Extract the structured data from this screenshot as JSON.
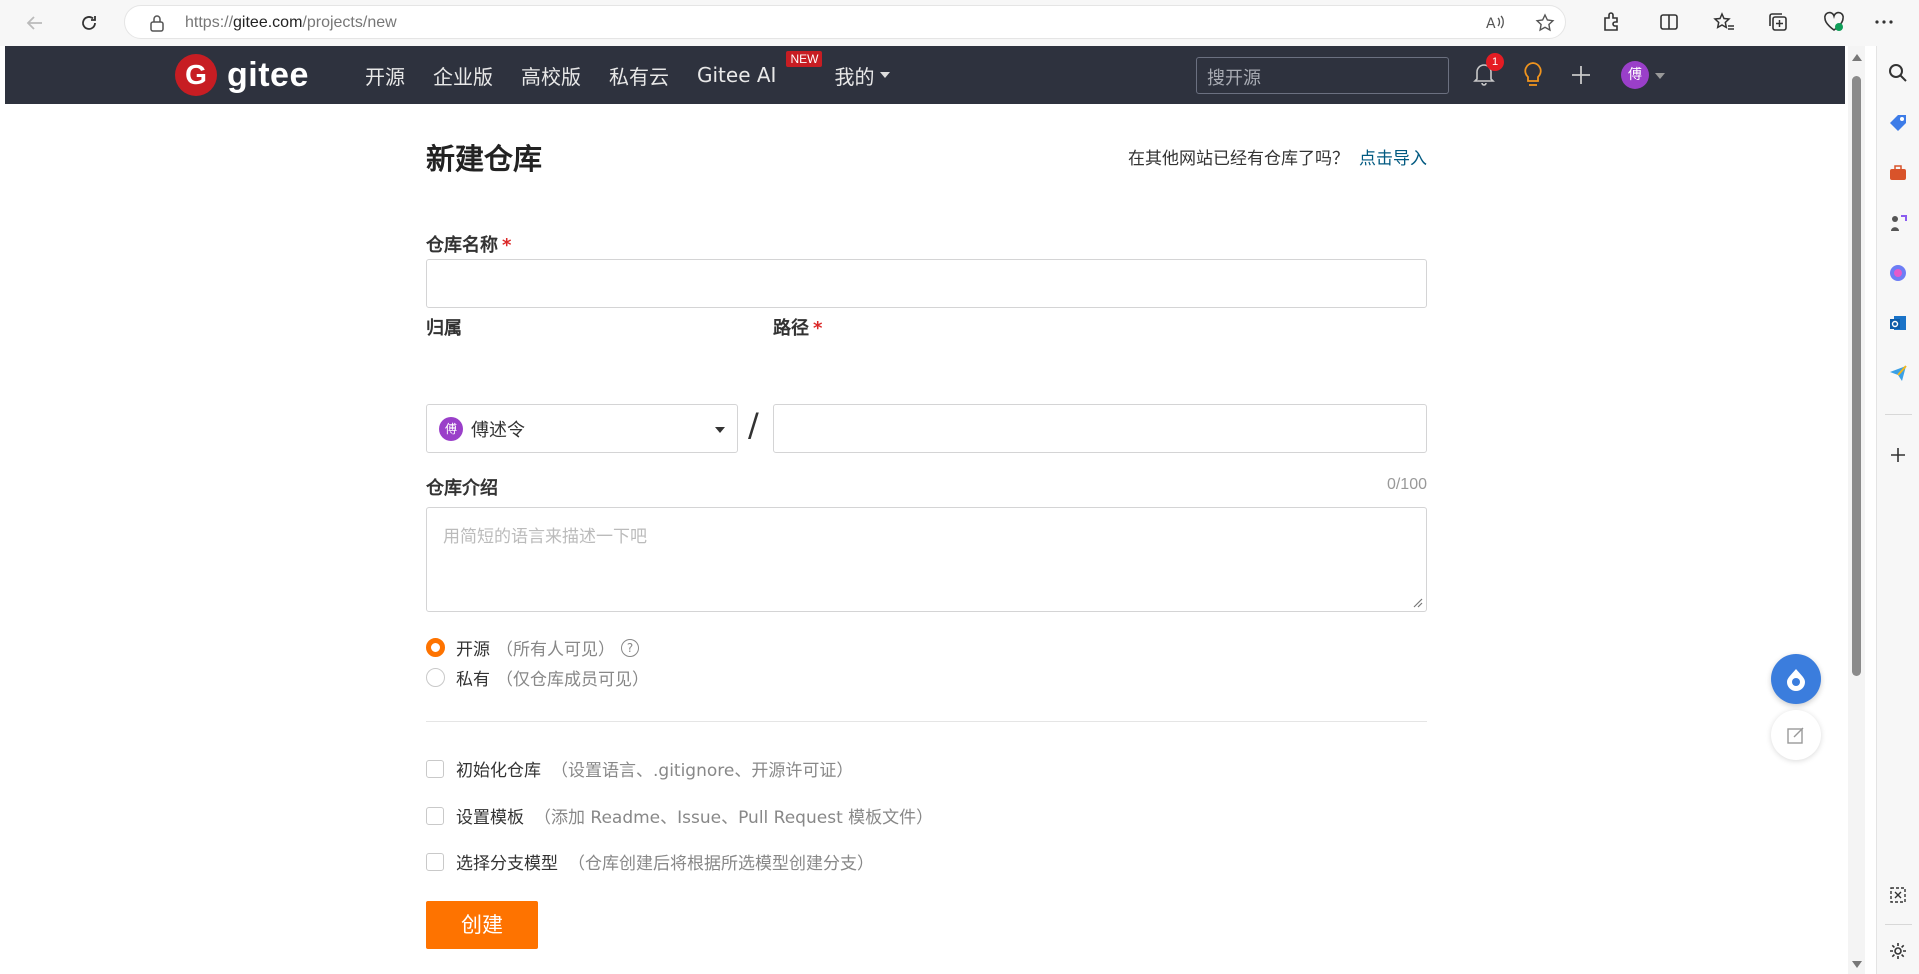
{
  "browser": {
    "url_prefix": "https://",
    "url_domain": "gitee.com",
    "url_path": "/projects/new"
  },
  "header": {
    "logo_letter": "G",
    "logo_text": "gitee",
    "nav": [
      "开源",
      "企业版",
      "高校版",
      "私有云",
      "Gitee AI",
      "我的"
    ],
    "new_badge": "NEW",
    "search_placeholder": "搜开源",
    "notification_count": "1",
    "avatar_initial": "傅"
  },
  "form": {
    "title": "新建仓库",
    "import_question": "在其他网站已经有仓库了吗？",
    "import_link": "点击导入",
    "repo_name_label": "仓库名称",
    "required_mark": "*",
    "owner_label": "归属",
    "owner_initial": "傅",
    "owner_name": "傅述令",
    "slash": "/",
    "path_label": "路径",
    "desc_label": "仓库介绍",
    "desc_counter": "0/100",
    "desc_placeholder": "用简短的语言来描述一下吧",
    "visibility": [
      {
        "label": "开源",
        "hint": "（所有人可见）",
        "selected": true,
        "help": "?"
      },
      {
        "label": "私有",
        "hint": "（仅仓库成员可见）",
        "selected": false
      }
    ],
    "options": [
      {
        "label": "初始化仓库",
        "hint": "（设置语言、.gitignore、开源许可证）",
        "checked": false
      },
      {
        "label": "设置模板",
        "hint": "（添加 Readme、Issue、Pull Request 模板文件）",
        "checked": false
      },
      {
        "label": "选择分支模型",
        "hint": "（仓库创建后将根据所选模型创建分支）",
        "checked": false
      }
    ],
    "submit_label": "创建"
  },
  "colors": {
    "header_bg": "#2e323e",
    "brand_red": "#c71d23",
    "accent_orange": "#fe7300",
    "link_blue": "#005980"
  }
}
